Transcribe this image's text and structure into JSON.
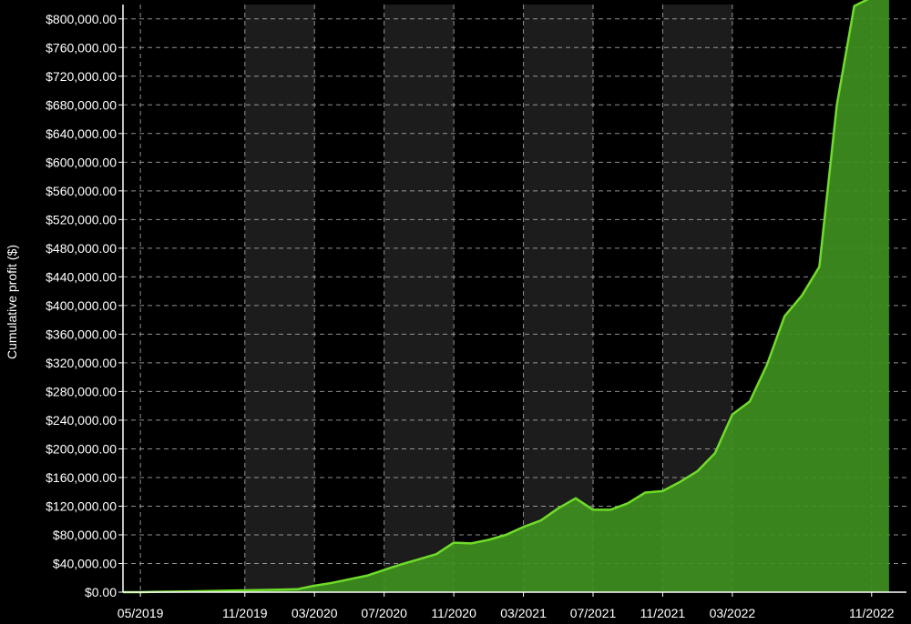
{
  "chart_data": {
    "type": "area",
    "title": "",
    "xlabel": "",
    "ylabel": "Cumulative profit ($)",
    "grid": true,
    "ylim": [
      0,
      820000
    ],
    "xlim": [
      "2019-04",
      "2023-01"
    ],
    "y_ticks": [
      0,
      40000,
      80000,
      120000,
      160000,
      200000,
      240000,
      280000,
      320000,
      360000,
      400000,
      440000,
      480000,
      520000,
      560000,
      600000,
      640000,
      680000,
      720000,
      760000,
      800000
    ],
    "y_tick_labels": [
      "$0.00",
      "$40,000.00",
      "$80,000.00",
      "$120,000.00",
      "$160,000.00",
      "$200,000.00",
      "$240,000.00",
      "$280,000.00",
      "$320,000.00",
      "$360,000.00",
      "$400,000.00",
      "$440,000.00",
      "$480,000.00",
      "$520,000.00",
      "$560,000.00",
      "$600,000.00",
      "$640,000.00",
      "$680,000.00",
      "$720,000.00",
      "$760,000.00",
      "$800,000.00"
    ],
    "x_ticks": [
      "2019-05",
      "2019-11",
      "2020-03",
      "2020-07",
      "2020-11",
      "2021-03",
      "2021-07",
      "2021-11",
      "2022-03",
      "2022-11"
    ],
    "x_tick_labels": [
      "05/2019",
      "11/2019",
      "03/2020",
      "07/2020",
      "11/2020",
      "03/2021",
      "07/2021",
      "11/2021",
      "03/2022",
      "11/2022"
    ],
    "shaded_bands": [
      [
        "2019-11",
        "2020-03"
      ],
      [
        "2020-07",
        "2020-11"
      ],
      [
        "2021-03",
        "2021-07"
      ],
      [
        "2021-11",
        "2022-03"
      ]
    ],
    "series": [
      {
        "x": [
          "2019-04",
          "2019-05",
          "2019-06",
          "2019-07",
          "2019-08",
          "2019-09",
          "2019-10",
          "2019-11",
          "2019-12",
          "2020-01",
          "2020-02",
          "2020-03",
          "2020-04",
          "2020-05",
          "2020-06",
          "2020-07",
          "2020-08",
          "2020-09",
          "2020-10",
          "2020-11",
          "2020-12",
          "2021-01",
          "2021-02",
          "2021-03",
          "2021-04",
          "2021-05",
          "2021-06",
          "2021-07",
          "2021-08",
          "2021-09",
          "2021-10",
          "2021-11",
          "2021-12",
          "2022-01",
          "2022-02",
          "2022-03",
          "2022-04",
          "2022-05",
          "2022-06",
          "2022-07",
          "2022-08",
          "2022-09",
          "2022-10",
          "2022-11",
          "2022-12"
        ],
        "values": [
          0,
          0,
          500,
          800,
          1200,
          1500,
          2000,
          2500,
          3000,
          3500,
          4000,
          9000,
          13000,
          18000,
          23000,
          31000,
          39000,
          46000,
          53000,
          69000,
          68000,
          73000,
          80000,
          91000,
          100000,
          117000,
          131000,
          115000,
          115000,
          124000,
          139000,
          141000,
          154000,
          169000,
          194000,
          248000,
          266000,
          318000,
          385000,
          414000,
          454000,
          680000,
          818000,
          830000,
          830000
        ]
      }
    ],
    "colors": {
      "line": "#6fdc2a",
      "fill": "#3f8f1f",
      "band": "#1c1c1c",
      "grid": "#bfbfbf",
      "background": "#000000"
    }
  }
}
